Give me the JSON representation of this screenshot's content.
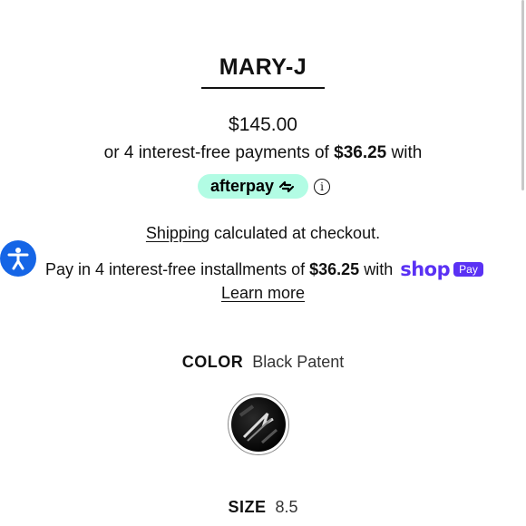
{
  "product": {
    "title": "MARY-J",
    "price": "$145.00"
  },
  "afterpay": {
    "text_prefix": "or 4 interest-free payments of ",
    "amount": "$36.25",
    "text_suffix": " with",
    "badge_label": "afterpay",
    "badge_color": "#b2fce4",
    "info_icon": "info-icon"
  },
  "shipping": {
    "link_label": "Shipping",
    "text": " calculated at checkout."
  },
  "shop_pay": {
    "text_prefix": "Pay in 4 interest-free installments of ",
    "amount": "$36.25",
    "text_suffix": " with",
    "brand_word": "shop",
    "pay_badge": "Pay",
    "brand_color": "#5a31f4",
    "learn_more": "Learn more"
  },
  "accessibility": {
    "icon": "accessibility-icon",
    "color": "#1565e6"
  },
  "options": {
    "color_label": "COLOR",
    "color_value": "Black Patent",
    "size_label": "SIZE",
    "size_value": "8.5"
  }
}
